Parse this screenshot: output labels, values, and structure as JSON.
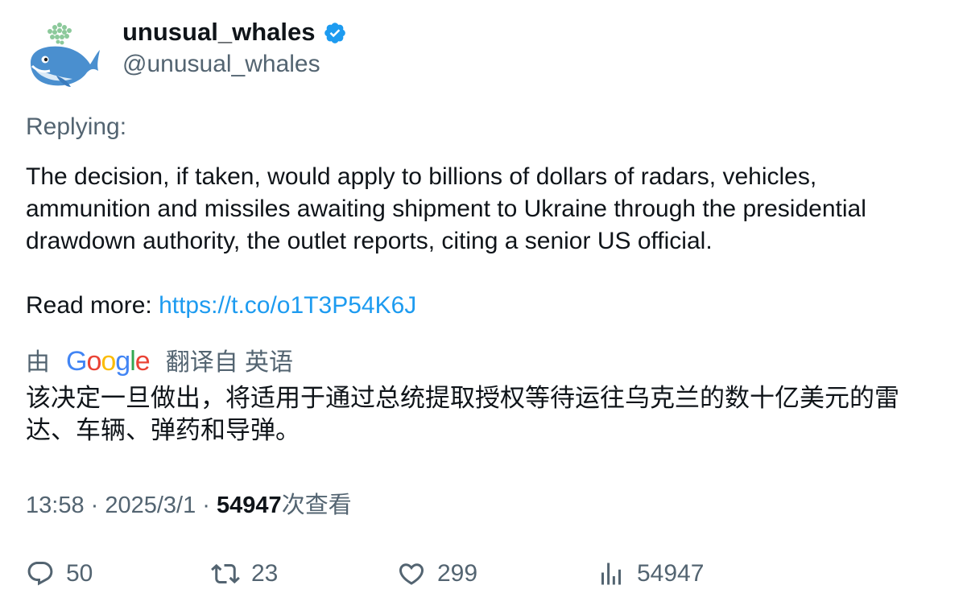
{
  "author": {
    "display_name": "unusual_whales",
    "handle": "@unusual_whales",
    "verified": true
  },
  "replying_label": "Replying:",
  "tweet": {
    "text_paragraph": "The decision, if taken, would apply to billions of dollars of radars, vehicles, ammunition and missiles awaiting shipment to Ukraine through the presidential drawdown authority, the outlet reports, citing a senior US official.",
    "read_more_label": "Read more: ",
    "link_text": "https://t.co/o1T3P54K6J"
  },
  "translation": {
    "prefix": "由",
    "provider": "Google",
    "suffix": "翻译自 英语",
    "text": "该决定一旦做出，将适用于通过总统提取授权等待运往乌克兰的数十亿美元的雷达、车辆、弹药和导弹。"
  },
  "meta": {
    "time": "13:58",
    "separator": " · ",
    "date": "2025/3/1",
    "views_count": "54947",
    "views_label": "次查看"
  },
  "actions": {
    "replies": "50",
    "retweets": "23",
    "likes": "299",
    "views": "54947"
  },
  "colors": {
    "link": "#1d9bf0",
    "secondary_text": "#536471",
    "primary_text": "#0f1419",
    "verified_badge": "#1d9bf0"
  },
  "icons": [
    "whale-avatar-icon",
    "verified-badge-icon",
    "reply-icon",
    "retweet-icon",
    "like-icon",
    "views-icon"
  ]
}
